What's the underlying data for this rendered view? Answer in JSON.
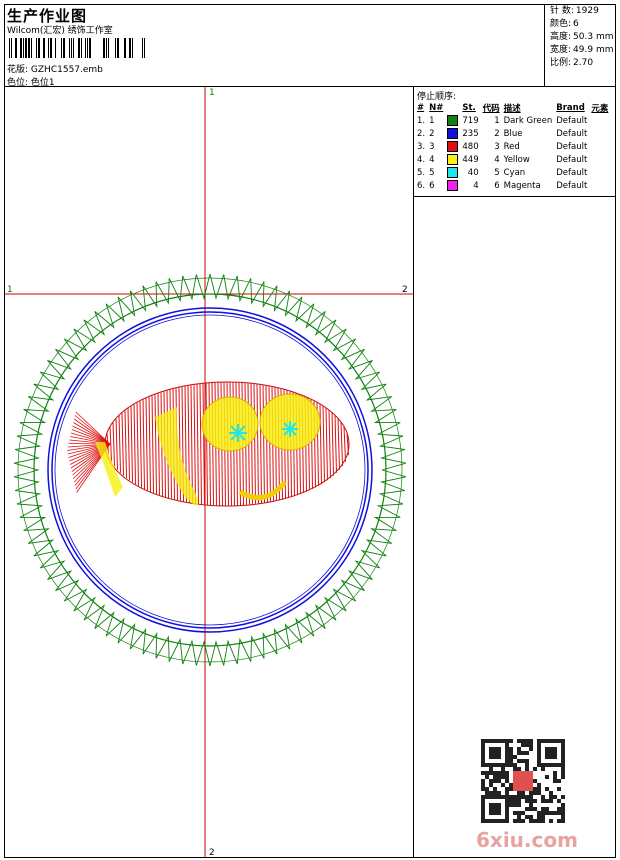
{
  "header": {
    "title": "生产作业图",
    "subtitle": "Wilcom(汇宏) 绣饰工作室",
    "file_label": "花版:",
    "file_name": "GZHC1557.emb",
    "colorway_label": "色位:",
    "colorway_name": "色位1"
  },
  "stats": [
    {
      "label": "针 数:",
      "value": "1929"
    },
    {
      "label": "颜色:",
      "value": "6"
    },
    {
      "label": "高度:",
      "value": "50.3 mm"
    },
    {
      "label": "宽度:",
      "value": "49.9 mm"
    },
    {
      "label": "比例:",
      "value": "2.70"
    }
  ],
  "legend": {
    "title": "停止顺序:",
    "headers": [
      "#",
      "N#",
      "St.",
      "代码",
      "描述",
      "Brand",
      "元素"
    ],
    "rows": [
      {
        "idx": "1.",
        "n": "1",
        "color": "#108010",
        "st": "719",
        "code": "1",
        "desc": "Dark Green",
        "brand": "Default"
      },
      {
        "idx": "2.",
        "n": "2",
        "color": "#1010e0",
        "st": "235",
        "code": "2",
        "desc": "Blue",
        "brand": "Default"
      },
      {
        "idx": "3.",
        "n": "3",
        "color": "#e01010",
        "st": "480",
        "code": "3",
        "desc": "Red",
        "brand": "Default"
      },
      {
        "idx": "4.",
        "n": "4",
        "color": "#f8f010",
        "st": "449",
        "code": "4",
        "desc": "Yellow",
        "brand": "Default"
      },
      {
        "idx": "5.",
        "n": "5",
        "color": "#20e8e8",
        "st": "40",
        "code": "5",
        "desc": "Cyan",
        "brand": "Default"
      },
      {
        "idx": "6.",
        "n": "6",
        "color": "#f020f0",
        "st": "4",
        "code": "6",
        "desc": "Magenta",
        "brand": "Default"
      }
    ]
  },
  "axis_labels": {
    "top": "1",
    "bottom": "2",
    "left": "1",
    "right": "2"
  },
  "watermark": "6xiu.com"
}
